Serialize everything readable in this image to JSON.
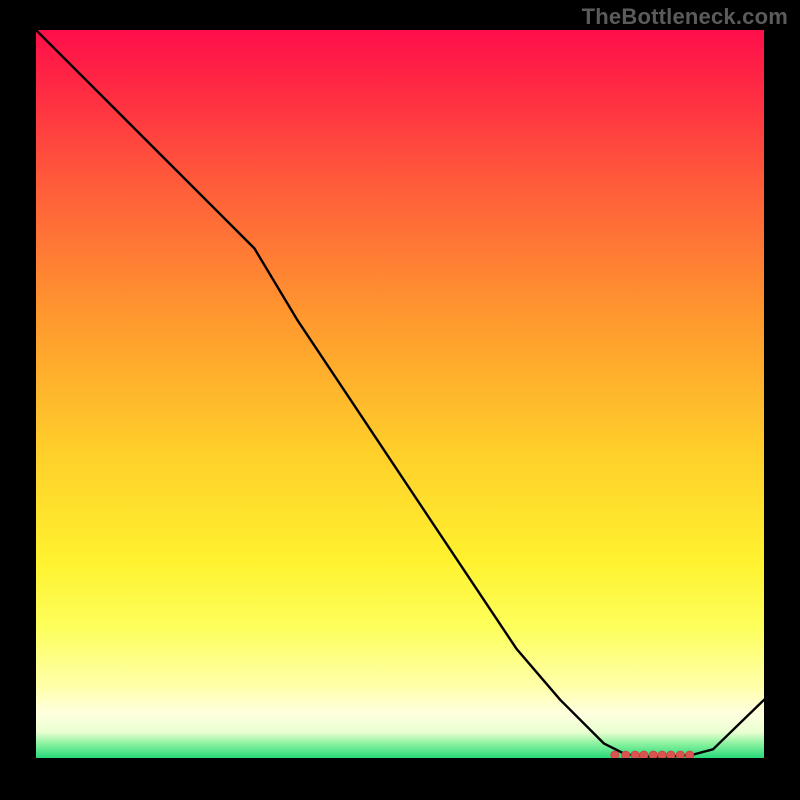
{
  "watermark": "TheBottleneck.com",
  "chart_data": {
    "type": "line",
    "title": "",
    "xlabel": "",
    "ylabel": "",
    "xlim": [
      0,
      100
    ],
    "ylim": [
      0,
      100
    ],
    "x": [
      0,
      6,
      12,
      18,
      24,
      30,
      36,
      42,
      48,
      54,
      60,
      66,
      72,
      78,
      81,
      84,
      87,
      90,
      93,
      100
    ],
    "values": [
      100,
      94,
      88,
      82,
      76,
      70,
      60,
      51,
      42,
      33,
      24,
      15,
      8,
      2,
      0.5,
      0.2,
      0.2,
      0.4,
      1.2,
      8
    ],
    "flat_region": {
      "x_start": 79,
      "x_end": 90,
      "y": 0.4,
      "dots_x": [
        79.5,
        81,
        82.3,
        83.5,
        84.8,
        86,
        87.2,
        88.5,
        89.8
      ]
    }
  }
}
